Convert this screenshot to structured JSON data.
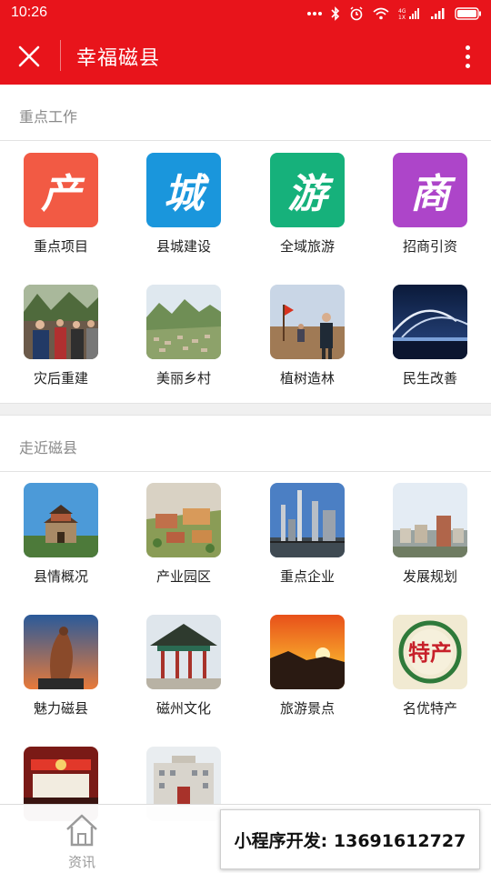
{
  "status_bar": {
    "time": "10:26",
    "network_badge": "4G\n1X"
  },
  "app": {
    "title": "幸福磁县"
  },
  "sections": [
    {
      "title": "重点工作",
      "items": [
        {
          "label": "重点项目",
          "char": "产",
          "color": "#f25a44"
        },
        {
          "label": "县城建设",
          "char": "城",
          "color": "#1a96dc"
        },
        {
          "label": "全域旅游",
          "char": "游",
          "color": "#16b17b"
        },
        {
          "label": "招商引资",
          "char": "商",
          "color": "#ad45c9"
        },
        {
          "label": "灾后重建",
          "image": "crowd-photo"
        },
        {
          "label": "美丽乡村",
          "image": "valley-village-photo"
        },
        {
          "label": "植树造林",
          "image": "tree-planting-photo"
        },
        {
          "label": "民生改善",
          "image": "arch-bridge-night-photo"
        }
      ]
    },
    {
      "title": "走近磁县",
      "items": [
        {
          "label": "县情概况",
          "image": "gate-tower-photo"
        },
        {
          "label": "产业园区",
          "image": "industrial-park-model-photo"
        },
        {
          "label": "重点企业",
          "image": "refinery-photo"
        },
        {
          "label": "发展规划",
          "image": "city-skyline-photo"
        },
        {
          "label": "魅力磁县",
          "image": "sculpture-sunset-photo"
        },
        {
          "label": "磁州文化",
          "image": "pavilion-photo"
        },
        {
          "label": "旅游景点",
          "image": "sunset-mountain-photo"
        },
        {
          "label": "名优特产",
          "image": "specialty-seal-photo",
          "seal_text": "特产"
        },
        {
          "label": "",
          "image": "stage-hall-photo"
        },
        {
          "label": "",
          "image": "government-building-photo"
        }
      ]
    }
  ],
  "bottom_nav": {
    "label": "资讯"
  },
  "promo_banner": {
    "text": "小程序开发: 13691612727"
  }
}
